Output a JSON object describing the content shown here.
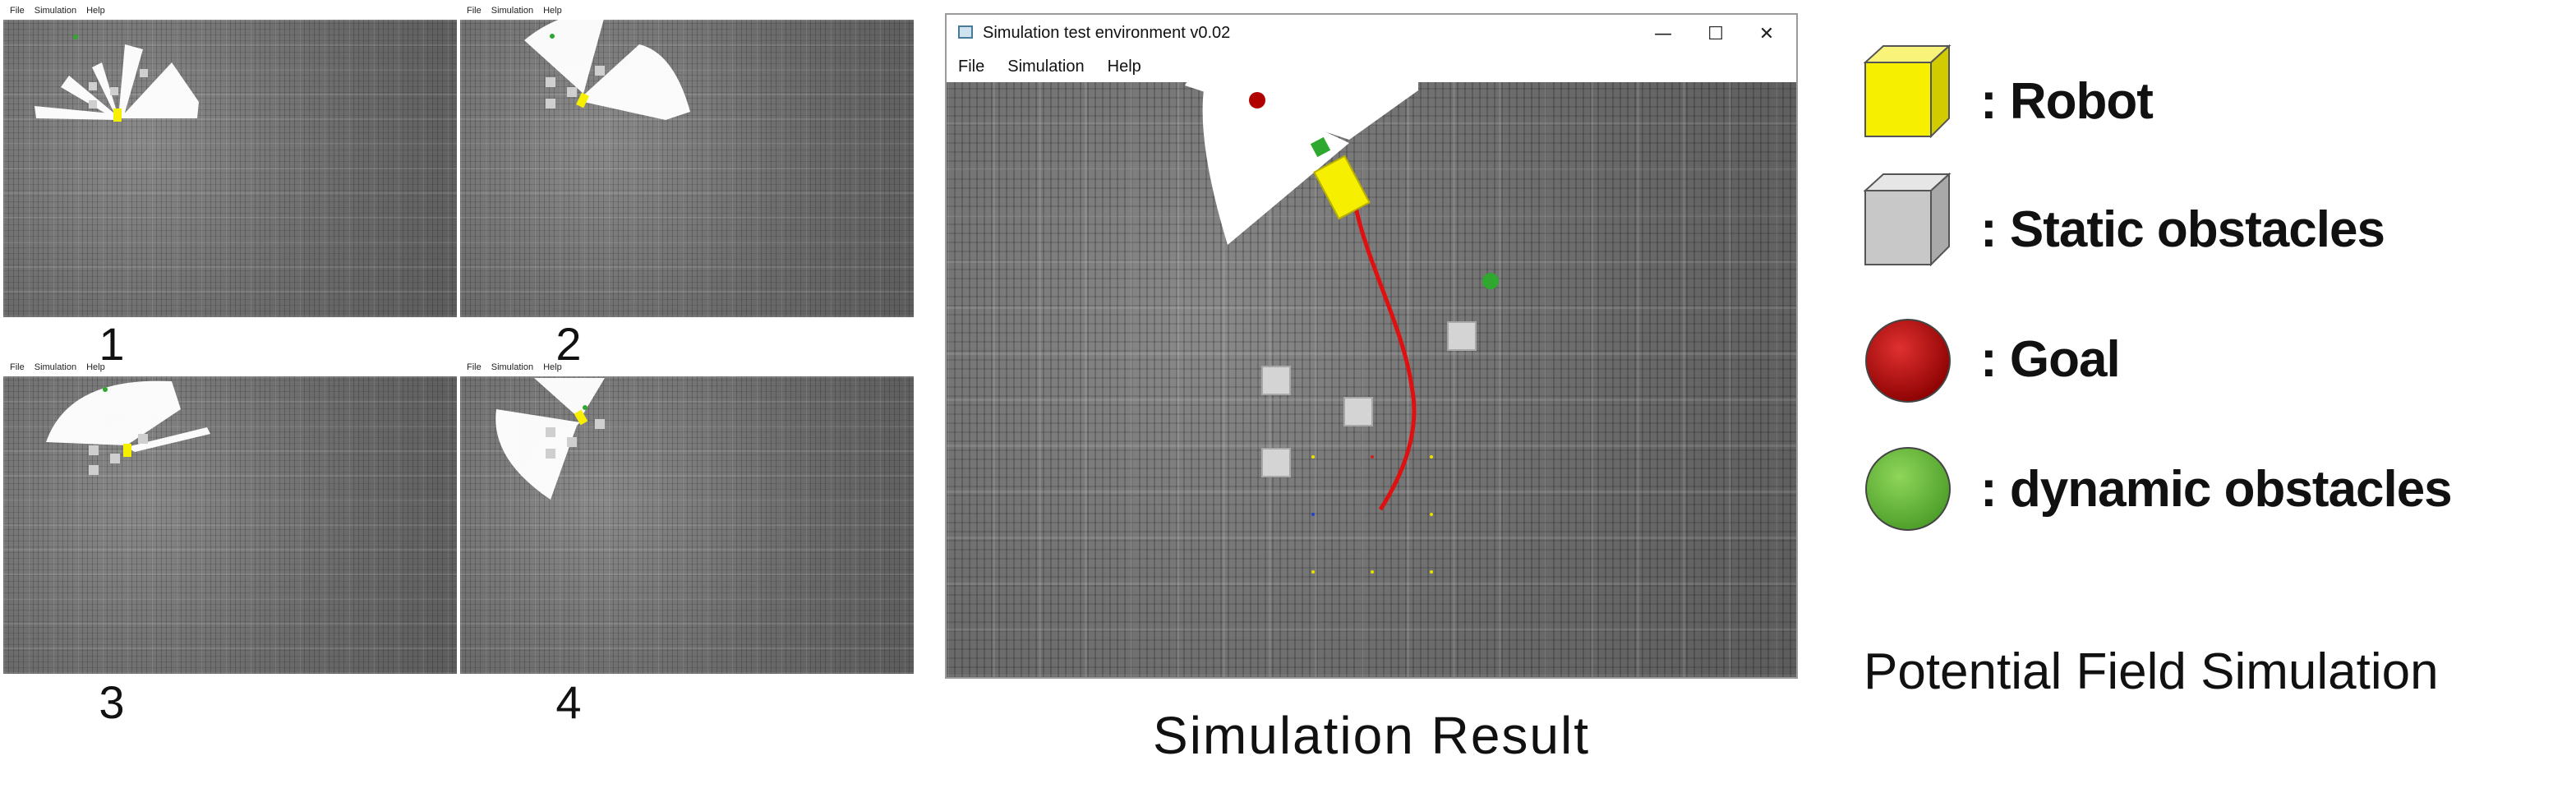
{
  "thumbnails": [
    {
      "menu": [
        "File",
        "Simulation",
        "Help"
      ],
      "caption": "1"
    },
    {
      "menu": [
        "File",
        "Simulation",
        "Help"
      ],
      "caption": "2"
    },
    {
      "menu": [
        "File",
        "Simulation",
        "Help"
      ],
      "caption": "3"
    },
    {
      "menu": [
        "File",
        "Simulation",
        "Help"
      ],
      "caption": "4"
    }
  ],
  "main_window": {
    "title": "Simulation test environment v0.02",
    "menu": [
      "File",
      "Simulation",
      "Help"
    ],
    "controls": {
      "minimize": "—",
      "maximize": "☐",
      "close": "✕"
    }
  },
  "main_caption": "Simulation Result",
  "legend": {
    "items": [
      {
        "label": ": Robot",
        "color": "#f6f000",
        "shape": "cube"
      },
      {
        "label": ": Static obstacles",
        "color": "#c8c8c8",
        "shape": "cube"
      },
      {
        "label": ": Goal",
        "color": "#b80000",
        "shape": "sphere"
      },
      {
        "label": ": dynamic obstacles",
        "color": "#5fb83a",
        "shape": "sphere"
      }
    ],
    "title": "Potential Field Simulation"
  },
  "colors": {
    "robot": "#f6f000",
    "static_obstacle": "#cfcfcf",
    "goal": "#b00000",
    "dynamic_obstacle": "#2fa82f",
    "path": "#e01010",
    "sensor": "#ffffff"
  }
}
